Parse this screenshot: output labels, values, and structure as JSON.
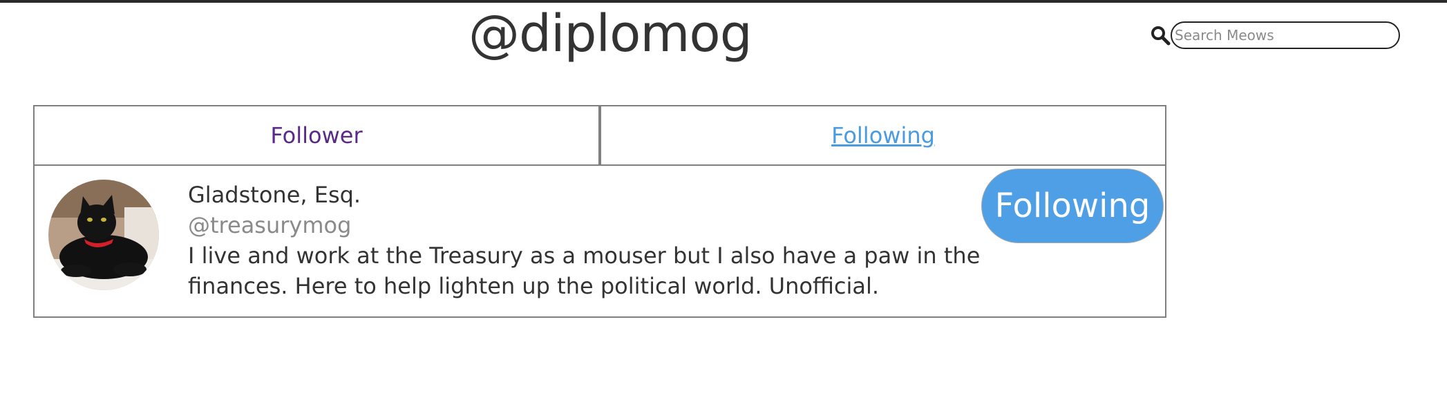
{
  "header": {
    "title": "@diplomog"
  },
  "search": {
    "placeholder": "Search Meows",
    "value": ""
  },
  "tabs": [
    {
      "label": "Follower"
    },
    {
      "label": "Following"
    }
  ],
  "users": [
    {
      "name": "Gladstone, Esq.",
      "handle": "@treasurymog",
      "bio": "I live and work at the Treasury as a mouser but I also have a paw in the finances. Here to help lighten up the political world. Unofficial.",
      "follow_label": "Following"
    }
  ],
  "colors": {
    "tab_follower": "#5a2a8a",
    "tab_following": "#4a9be0",
    "follow_button": "#4f9fe6"
  }
}
